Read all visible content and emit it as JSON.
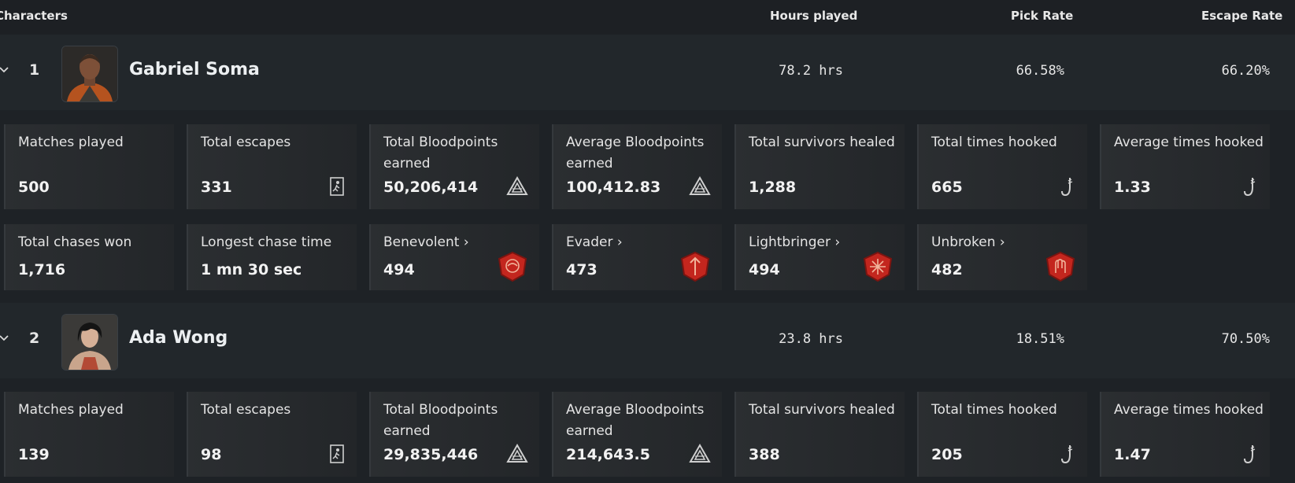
{
  "header": {
    "characters": "Characters",
    "hours": "Hours played",
    "pick": "Pick Rate",
    "escape": "Escape Rate"
  },
  "characters": [
    {
      "rank": "1",
      "name": "Gabriel Soma",
      "hours": "78.2 hrs",
      "pick_rate": "66.58%",
      "escape_rate": "66.20%",
      "stats": [
        {
          "label": "Matches played",
          "value": "500"
        },
        {
          "label": "Total escapes",
          "value": "331",
          "icon": "escape-icon"
        },
        {
          "label": "Total Bloodpoints earned",
          "value": "50,206,414",
          "icon": "bloodpoints-icon"
        },
        {
          "label": "Average Bloodpoints earned",
          "value": "100,412.83",
          "icon": "bloodpoints-icon"
        },
        {
          "label": "Total survivors healed",
          "value": "1,288"
        },
        {
          "label": "Total times hooked",
          "value": "665",
          "icon": "hook-icon"
        },
        {
          "label": "Average times hooked",
          "value": "1.33",
          "icon": "hook-icon"
        }
      ],
      "stats2": [
        {
          "label": "Total chases won",
          "value": "1,716"
        },
        {
          "label": "Longest chase time",
          "value": "1 mn 30 sec"
        },
        {
          "label": "Benevolent",
          "value": "494",
          "icon": "benevolent-emblem-icon"
        },
        {
          "label": "Evader",
          "value": "473",
          "icon": "evader-emblem-icon"
        },
        {
          "label": "Lightbringer",
          "value": "494",
          "icon": "lightbringer-emblem-icon"
        },
        {
          "label": "Unbroken",
          "value": "482",
          "icon": "unbroken-emblem-icon"
        }
      ]
    },
    {
      "rank": "2",
      "name": "Ada Wong",
      "hours": "23.8 hrs",
      "pick_rate": "18.51%",
      "escape_rate": "70.50%",
      "stats": [
        {
          "label": "Matches played",
          "value": "139"
        },
        {
          "label": "Total escapes",
          "value": "98",
          "icon": "escape-icon"
        },
        {
          "label": "Total Bloodpoints earned",
          "value": "29,835,446",
          "icon": "bloodpoints-icon"
        },
        {
          "label": "Average Bloodpoints earned",
          "value": "214,643.5",
          "icon": "bloodpoints-icon"
        },
        {
          "label": "Total survivors healed",
          "value": "388"
        },
        {
          "label": "Total times hooked",
          "value": "205",
          "icon": "hook-icon"
        },
        {
          "label": "Average times hooked",
          "value": "1.47",
          "icon": "hook-icon"
        }
      ]
    }
  ],
  "ui": {
    "chevron": "⌄",
    "emblem_arrow": "›"
  },
  "colors": {
    "background": "#1e2226",
    "emblem_red": "#c3261e",
    "card": "#2b2e31"
  }
}
